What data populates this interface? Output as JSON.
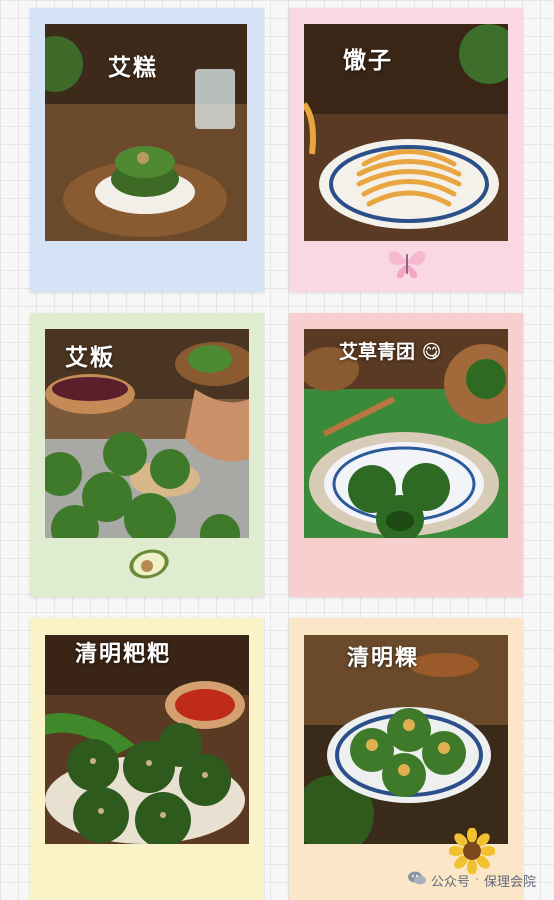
{
  "cards": [
    {
      "title": "艾糕",
      "frame_color": "#d6e3f7"
    },
    {
      "title": "馓子",
      "frame_color": "#f9d7e3"
    },
    {
      "title": "艾粄",
      "frame_color": "#dfeccf"
    },
    {
      "title": "艾草青团 😋",
      "frame_color": "#f7cfcf"
    },
    {
      "title": "清明粑粑",
      "frame_color": "#faf3c8"
    },
    {
      "title": "清明粿",
      "frame_color": "#fbe6c8"
    }
  ],
  "stickers": {
    "butterfly": "butterfly-icon",
    "avocado": "avocado-icon",
    "sunflower": "sunflower-icon"
  },
  "watermark": {
    "icon": "wechat-icon",
    "prefix": "公众号",
    "separator": "·",
    "account": "保理会院"
  }
}
